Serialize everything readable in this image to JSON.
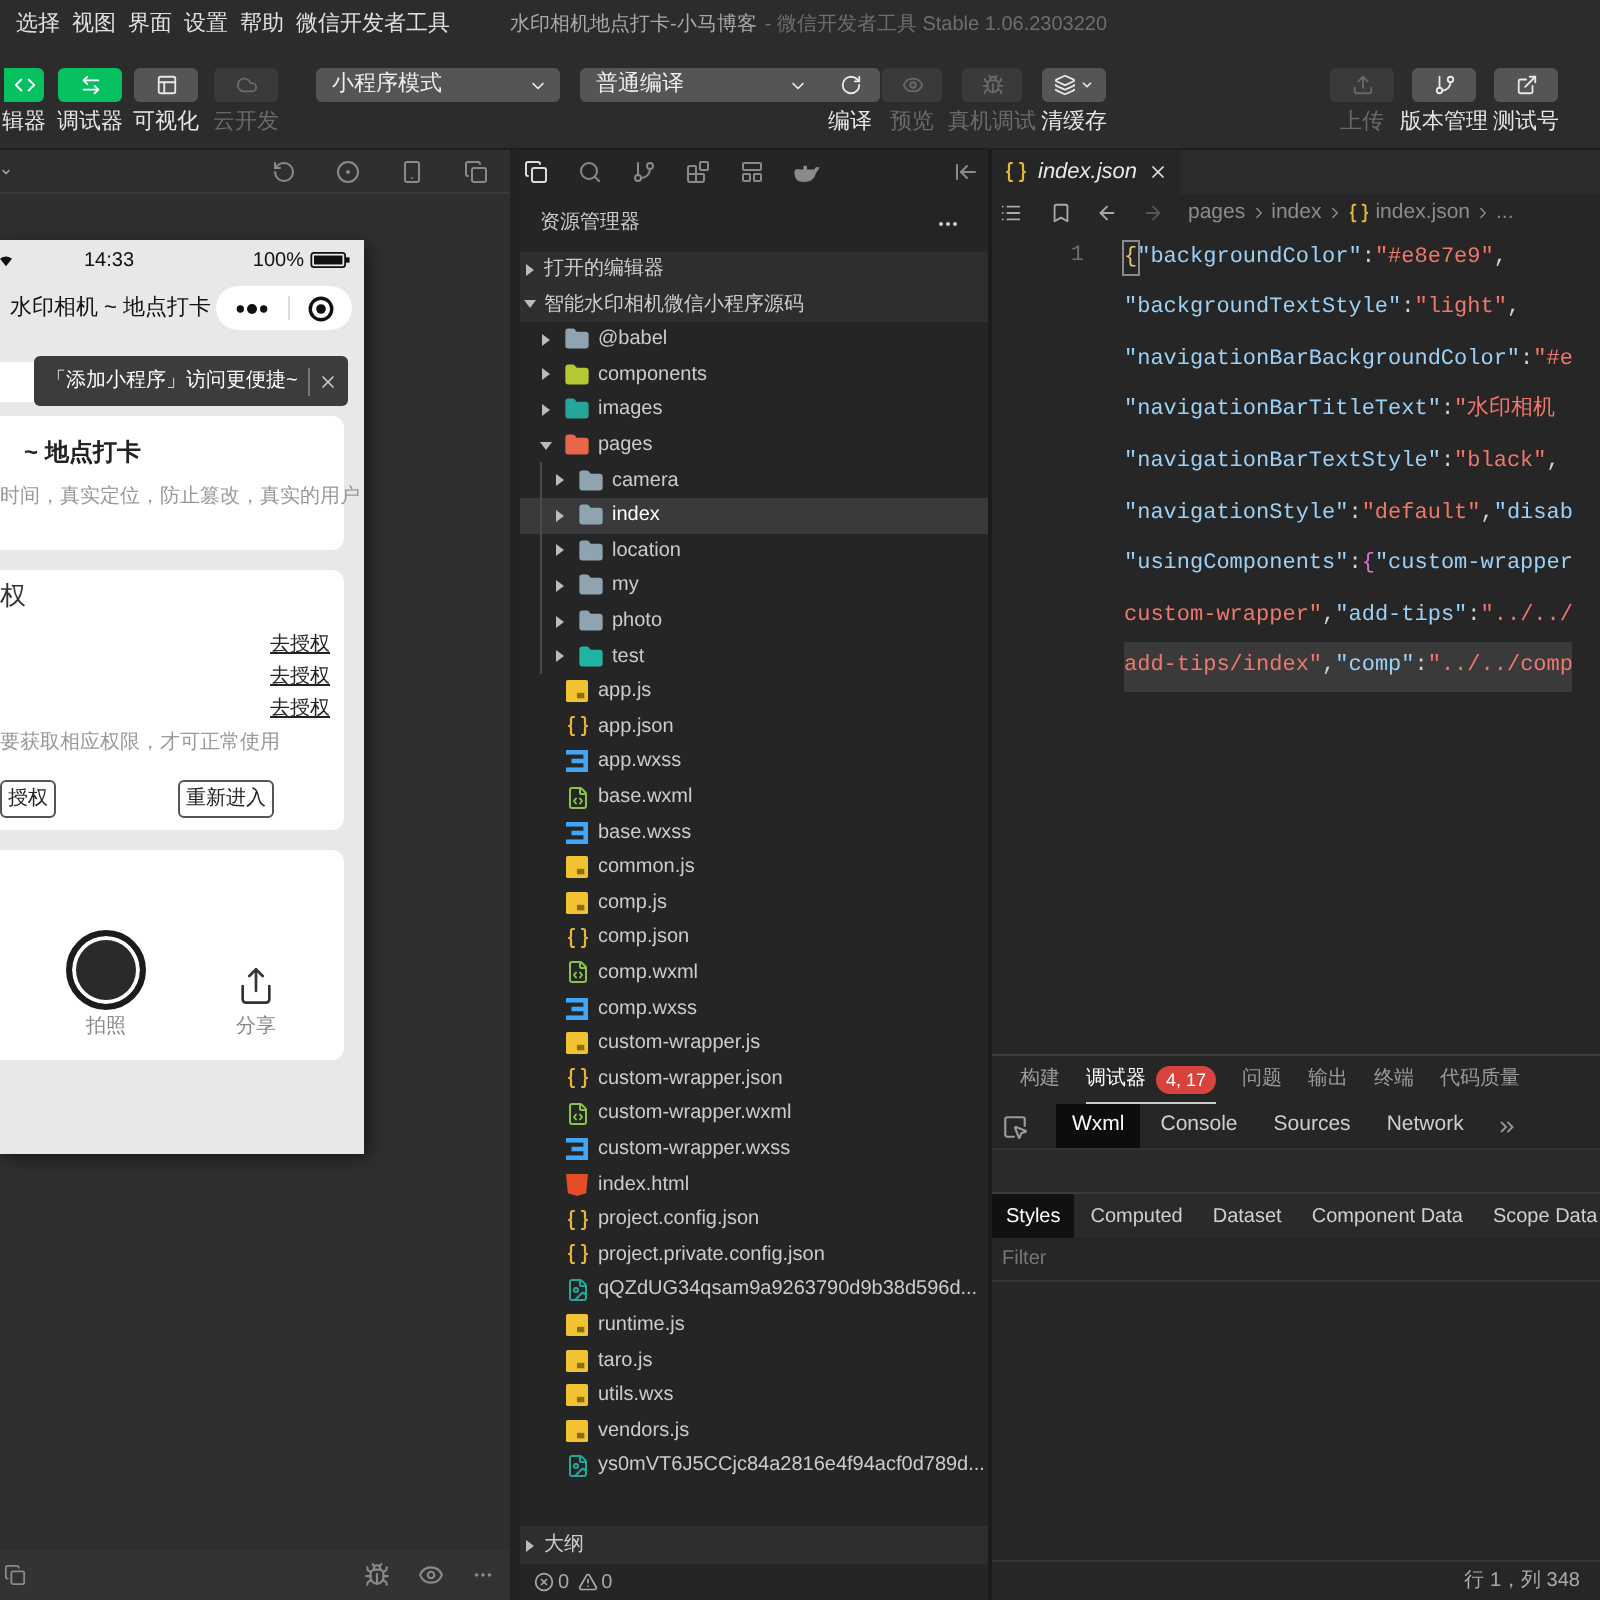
{
  "menu_bar": {
    "items": [
      "选择",
      "视图",
      "界面",
      "设置",
      "帮助",
      "微信开发者工具"
    ],
    "title": "水印相机地点打卡-小马博客",
    "subtitle": "- 微信开发者工具 Stable 1.06.2303220"
  },
  "toolbar": {
    "view_toggles": [
      {
        "label": "辑器",
        "selected": true,
        "disabled": false
      },
      {
        "label": "调试器",
        "selected": true,
        "disabled": false
      },
      {
        "label": "可视化",
        "selected": false,
        "disabled": false
      },
      {
        "label": "云开发",
        "selected": false,
        "disabled": true
      }
    ],
    "mode_select": {
      "value": "小程序模式"
    },
    "compile_select": {
      "value": "普通编译"
    },
    "actions": [
      {
        "label": "编译",
        "disabled": false
      },
      {
        "label": "预览",
        "disabled": true
      },
      {
        "label": "真机调试",
        "disabled": true
      },
      {
        "label": "清缓存",
        "disabled": false
      }
    ],
    "right_actions": [
      {
        "label": "上传",
        "disabled": true
      },
      {
        "label": "版本管理",
        "disabled": false
      },
      {
        "label": "测试号",
        "disabled": false
      }
    ]
  },
  "simulator": {
    "status_bar": {
      "time": "14:33",
      "battery": "100%"
    },
    "nav_title": "水印相机 ~ 地点打卡",
    "tip": {
      "text": "「添加小程序」访问更便捷~"
    },
    "intro_card": {
      "title": "~ 地点打卡",
      "description": "时间，真实定位，防止篡改，真实的用户"
    },
    "permission_card": {
      "title": "权",
      "links": [
        "去授权",
        "去授权",
        "去授权"
      ],
      "note": "要获取相应权限，才可正常使用",
      "buttons": [
        "授权",
        "重新进入"
      ]
    },
    "action_card": {
      "actions": [
        {
          "kind": "shutter",
          "label": "拍照"
        },
        {
          "kind": "share",
          "label": "分享"
        }
      ]
    }
  },
  "explorer": {
    "title": "资源管理器",
    "sections": [
      {
        "label": "打开的编辑器",
        "expanded": false
      },
      {
        "label": "智能水印相机微信小程序源码",
        "expanded": true,
        "tree": [
          {
            "name": "@babel",
            "kind": "folder",
            "color": "#8fa3b0",
            "expanded": false,
            "selected": false
          },
          {
            "name": "components",
            "kind": "folder",
            "color": "#b5c934",
            "expanded": false,
            "selected": false
          },
          {
            "name": "images",
            "kind": "folder",
            "color": "#26a69a",
            "expanded": false,
            "selected": false
          },
          {
            "name": "pages",
            "kind": "folder",
            "color": "#e8664a",
            "expanded": true,
            "selected": false,
            "children": [
              {
                "name": "camera",
                "kind": "folder",
                "color": "#8fa3b0",
                "expanded": false,
                "selected": false
              },
              {
                "name": "index",
                "kind": "folder",
                "color": "#8fa3b0",
                "expanded": false,
                "selected": true
              },
              {
                "name": "location",
                "kind": "folder",
                "color": "#8fa3b0",
                "expanded": false,
                "selected": false
              },
              {
                "name": "my",
                "kind": "folder",
                "color": "#8fa3b0",
                "expanded": false,
                "selected": false
              },
              {
                "name": "photo",
                "kind": "folder",
                "color": "#8fa3b0",
                "expanded": false,
                "selected": false
              },
              {
                "name": "test",
                "kind": "folder",
                "color": "#1fb5a0",
                "expanded": false,
                "selected": false
              }
            ]
          },
          {
            "name": "app.js",
            "kind": "js",
            "selected": false
          },
          {
            "name": "app.json",
            "kind": "json",
            "selected": false
          },
          {
            "name": "app.wxss",
            "kind": "wxss",
            "selected": false
          },
          {
            "name": "base.wxml",
            "kind": "wxml",
            "selected": false
          },
          {
            "name": "base.wxss",
            "kind": "wxss",
            "selected": false
          },
          {
            "name": "common.js",
            "kind": "js",
            "selected": false
          },
          {
            "name": "comp.js",
            "kind": "js",
            "selected": false
          },
          {
            "name": "comp.json",
            "kind": "json",
            "selected": false
          },
          {
            "name": "comp.wxml",
            "kind": "wxml",
            "selected": false
          },
          {
            "name": "comp.wxss",
            "kind": "wxss",
            "selected": false
          },
          {
            "name": "custom-wrapper.js",
            "kind": "js",
            "selected": false
          },
          {
            "name": "custom-wrapper.json",
            "kind": "json",
            "selected": false
          },
          {
            "name": "custom-wrapper.wxml",
            "kind": "wxml",
            "selected": false
          },
          {
            "name": "custom-wrapper.wxss",
            "kind": "wxss",
            "selected": false
          },
          {
            "name": "index.html",
            "kind": "html",
            "selected": false
          },
          {
            "name": "project.config.json",
            "kind": "json",
            "selected": false
          },
          {
            "name": "project.private.config.json",
            "kind": "json",
            "selected": false
          },
          {
            "name": "qQZdUG34qsam9a9263790d9b38d596d...",
            "kind": "image",
            "selected": false
          },
          {
            "name": "runtime.js",
            "kind": "js",
            "selected": false
          },
          {
            "name": "taro.js",
            "kind": "js",
            "selected": false
          },
          {
            "name": "utils.wxs",
            "kind": "js",
            "selected": false
          },
          {
            "name": "vendors.js",
            "kind": "js",
            "selected": false
          },
          {
            "name": "ys0mVT6J5CCjc84a2816e4f94acf0d789d...",
            "kind": "image",
            "selected": false
          }
        ]
      }
    ],
    "outline": {
      "label": "大纲",
      "expanded": false
    },
    "problems": {
      "errors": "0",
      "warnings": "0"
    }
  },
  "editor": {
    "tab": {
      "label": "index.json",
      "selected": true
    },
    "breadcrumb": [
      {
        "kind": "folder",
        "label": "pages"
      },
      {
        "kind": "folder",
        "label": "index"
      },
      {
        "kind": "file",
        "label": "index.json"
      },
      {
        "kind": "more",
        "label": "..."
      }
    ],
    "line_number": "1",
    "rows": [
      {
        "highlighted": false,
        "tokens": [
          {
            "kind": "matched_brace",
            "text": "{"
          },
          {
            "kind": "key",
            "text": "\"backgroundColor\""
          },
          {
            "kind": "punct",
            "text": ":"
          },
          {
            "kind": "string",
            "text": "\"#e8e7e9\""
          },
          {
            "kind": "punct",
            "text": ","
          }
        ]
      },
      {
        "highlighted": false,
        "tokens": [
          {
            "kind": "key",
            "text": "\"backgroundTextStyle\""
          },
          {
            "kind": "punct",
            "text": ":"
          },
          {
            "kind": "string",
            "text": "\"light\""
          },
          {
            "kind": "punct",
            "text": ","
          }
        ]
      },
      {
        "highlighted": false,
        "tokens": [
          {
            "kind": "key",
            "text": "\"navigationBarBackgroundColor\""
          },
          {
            "kind": "punct",
            "text": ":"
          },
          {
            "kind": "string",
            "text": "\"#e"
          }
        ]
      },
      {
        "highlighted": false,
        "tokens": [
          {
            "kind": "key",
            "text": "\"navigationBarTitleText\""
          },
          {
            "kind": "punct",
            "text": ":"
          },
          {
            "kind": "string",
            "text": "\"水印相机"
          }
        ]
      },
      {
        "highlighted": false,
        "tokens": [
          {
            "kind": "key",
            "text": "\"navigationBarTextStyle\""
          },
          {
            "kind": "punct",
            "text": ":"
          },
          {
            "kind": "string",
            "text": "\"black\""
          },
          {
            "kind": "punct",
            "text": ","
          }
        ]
      },
      {
        "highlighted": false,
        "tokens": [
          {
            "kind": "key",
            "text": "\"navigationStyle\""
          },
          {
            "kind": "punct",
            "text": ":"
          },
          {
            "kind": "string",
            "text": "\"default\""
          },
          {
            "kind": "punct",
            "text": ","
          },
          {
            "kind": "key",
            "text": "\"disab"
          }
        ]
      },
      {
        "highlighted": false,
        "tokens": [
          {
            "kind": "key",
            "text": "\"usingComponents\""
          },
          {
            "kind": "punct",
            "text": ":"
          },
          {
            "kind": "brace",
            "text": "{"
          },
          {
            "kind": "key",
            "text": "\"custom-wrapper"
          }
        ]
      },
      {
        "highlighted": false,
        "tokens": [
          {
            "kind": "string",
            "text": "custom-wrapper\""
          },
          {
            "kind": "punct",
            "text": ","
          },
          {
            "kind": "key",
            "text": "\"add-tips\""
          },
          {
            "kind": "punct",
            "text": ":"
          },
          {
            "kind": "string",
            "text": "\"../../"
          }
        ]
      },
      {
        "highlighted": true,
        "tokens": [
          {
            "kind": "string",
            "text": "add-tips/index\""
          },
          {
            "kind": "punct",
            "text": ","
          },
          {
            "kind": "key",
            "text": "\"comp\""
          },
          {
            "kind": "punct",
            "text": ":"
          },
          {
            "kind": "string",
            "text": "\"../../comp"
          }
        ]
      }
    ]
  },
  "devtools": {
    "panel_tabs": [
      {
        "label": "构建",
        "selected": false
      },
      {
        "label": "调试器",
        "selected": true,
        "badge": "4, 17"
      },
      {
        "label": "问题",
        "selected": false
      },
      {
        "label": "输出",
        "selected": false
      },
      {
        "label": "终端",
        "selected": false
      },
      {
        "label": "代码质量",
        "selected": false
      }
    ],
    "inspector_tabs": [
      {
        "label": "Wxml",
        "selected": true
      },
      {
        "label": "Console",
        "selected": false
      },
      {
        "label": "Sources",
        "selected": false
      },
      {
        "label": "Network",
        "selected": false
      }
    ],
    "style_tabs": [
      {
        "label": "Styles",
        "selected": true
      },
      {
        "label": "Computed",
        "selected": false
      },
      {
        "label": "Dataset",
        "selected": false
      },
      {
        "label": "Component Data",
        "selected": false
      },
      {
        "label": "Scope Data",
        "selected": false
      }
    ],
    "filter": {
      "placeholder": "Filter"
    }
  },
  "status_bar": {
    "cursor_position": "行 1，列 348"
  }
}
